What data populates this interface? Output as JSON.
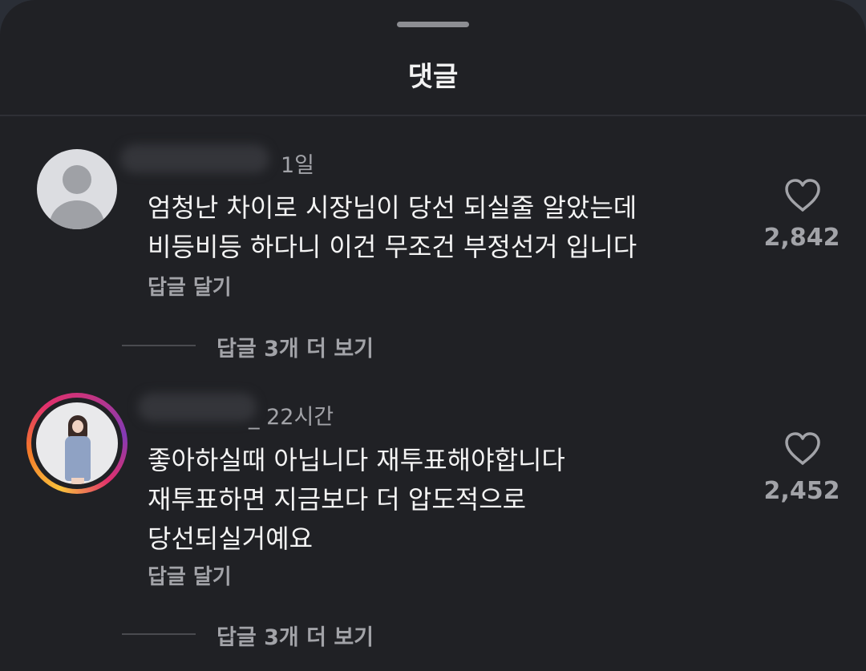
{
  "sheet": {
    "title": "댓글"
  },
  "comments": [
    {
      "time": "1일",
      "text": "엄청난 차이로 시장님이 당선 되실줄 알았는데\n비등비등 하다니 이건 무조건 부정선거 입니다",
      "reply_label": "답글 달기",
      "more_replies": "답글 3개 더 보기",
      "likes": "2,842"
    },
    {
      "time": "_ 22시간",
      "text": "좋아하실때 아닙니다 재투표해야합니다\n재투표하면 지금보다 더 압도적으로\n당선되실거예요",
      "reply_label": "답글 달기",
      "more_replies": "답글 3개 더 보기",
      "likes": "2,452"
    }
  ],
  "icons": {
    "like": "heart-outline-icon",
    "avatar_default": "default-avatar-icon"
  },
  "colors": {
    "background": "#202125",
    "text": "#f4f4f4",
    "muted": "#a2a3a8"
  }
}
